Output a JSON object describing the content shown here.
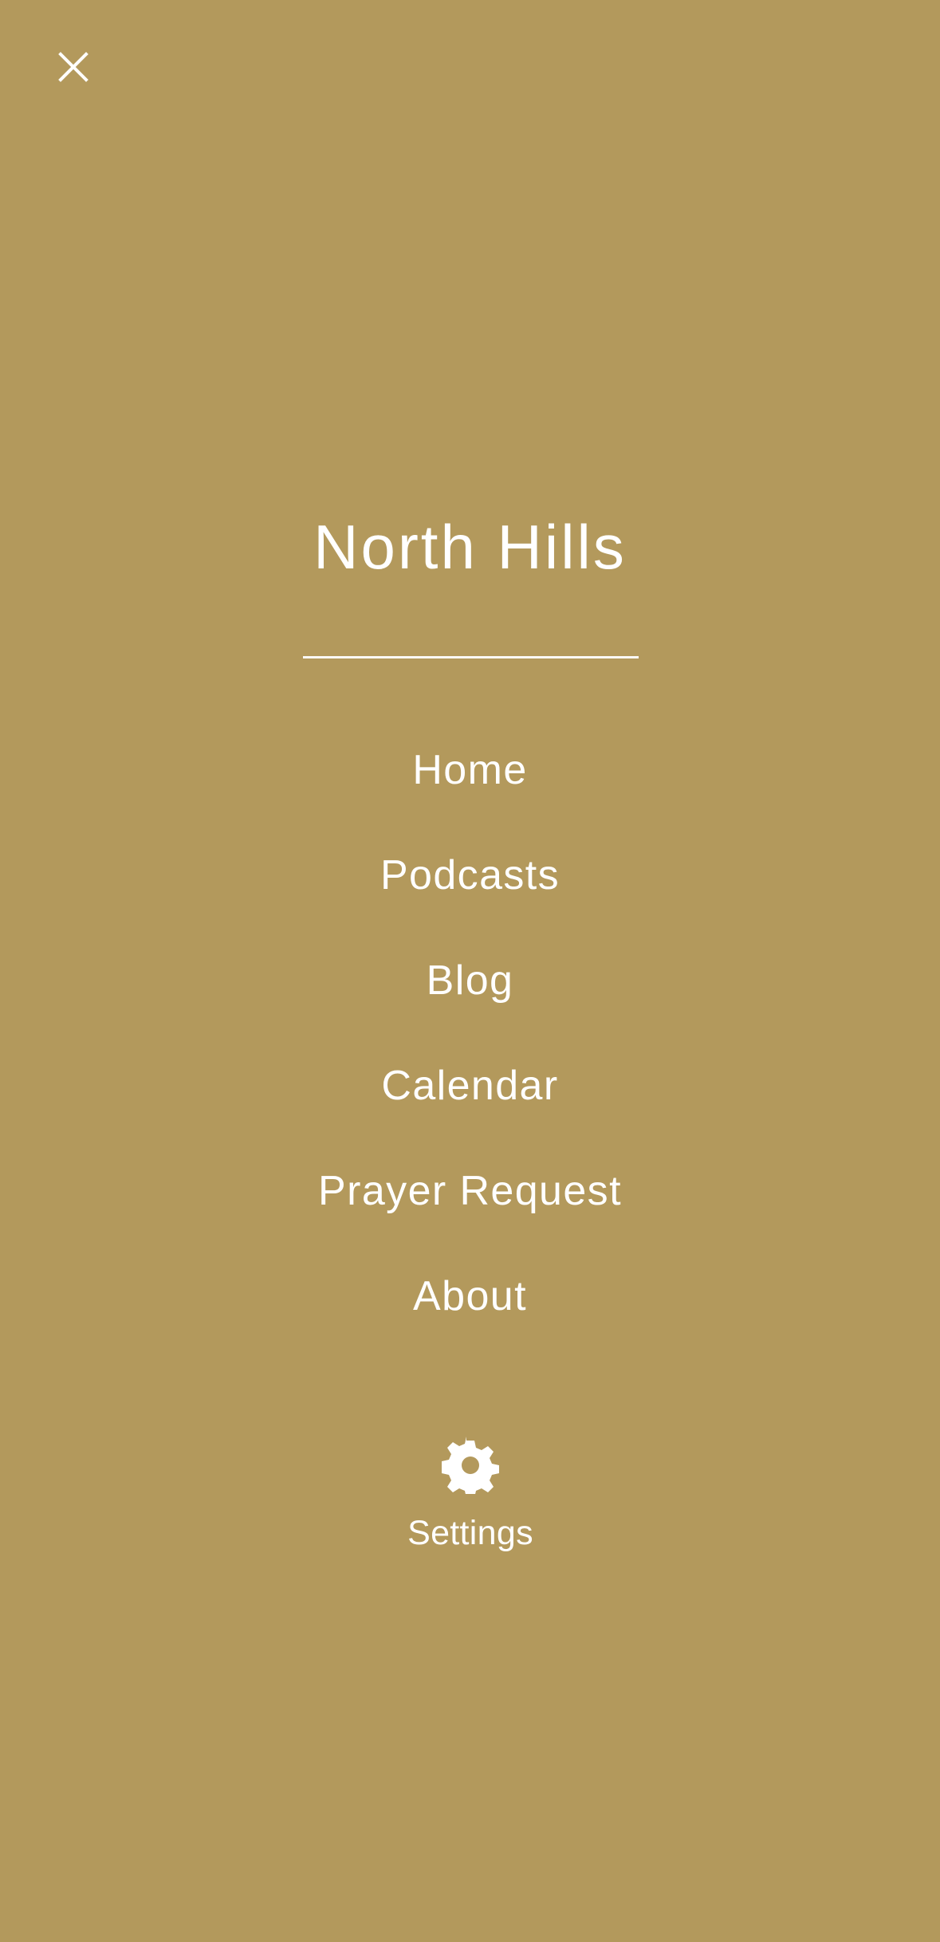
{
  "theme": {
    "background": "#b3995c",
    "foreground": "#ffffff"
  },
  "header": {
    "close_icon": "close-icon"
  },
  "brand": {
    "title": "North Hills"
  },
  "navigation": {
    "items": [
      {
        "label": "Home"
      },
      {
        "label": "Podcasts"
      },
      {
        "label": "Blog"
      },
      {
        "label": "Calendar"
      },
      {
        "label": "Prayer Request"
      },
      {
        "label": "About"
      }
    ]
  },
  "settings": {
    "icon": "gear-icon",
    "label": "Settings"
  }
}
